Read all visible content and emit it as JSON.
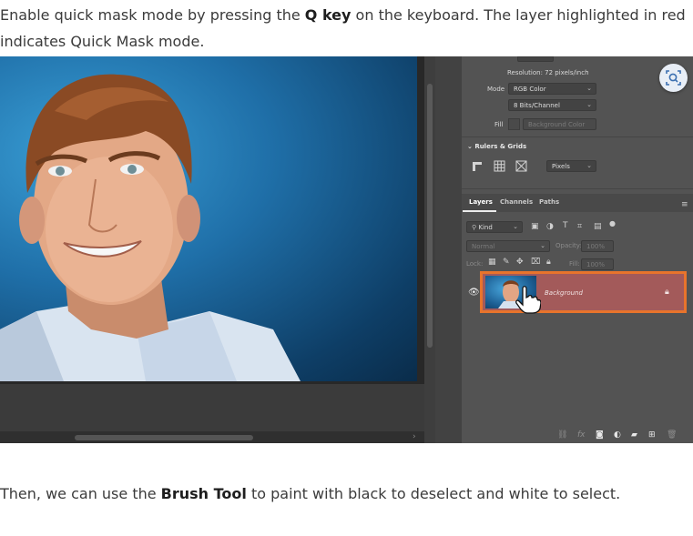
{
  "intro": {
    "text_before": "Enable quick mask mode by pressing the ",
    "key": "Q key",
    "text_after": " on the keyboard. The layer highlighted in red indicates Quick Mask mode."
  },
  "outro": {
    "text_before": "Then, we can use the ",
    "tool": "Brush Tool",
    "text_after": " to paint with black to deselect and white to select."
  },
  "panel": {
    "resolution": "Resolution: 72 pixels/inch",
    "mode_label": "Mode",
    "mode_value": "RGB Color",
    "bits_value": "8 Bits/Channel",
    "fill_label": "Fill",
    "fill_value": "Background Color",
    "rulers_title": "Rulers & Grids",
    "units_value": "Pixels"
  },
  "layers": {
    "tabs": [
      "Layers",
      "Channels",
      "Paths"
    ],
    "kind_placeholder": "Kind",
    "blend_mode": "Normal",
    "opacity_label": "Opacity:",
    "opacity_value": "100%",
    "lock_label": "Lock:",
    "fill_label": "Fill:",
    "fill_value": "100%",
    "layer_name": "Background"
  },
  "colors": {
    "quick_mask_highlight": "#a35a5a",
    "callout_border": "#e8742c",
    "panel_bg": "#535353"
  },
  "icons": [
    "search-icon",
    "eye-icon",
    "lock-icon",
    "hand-cursor-icon",
    "link-icon",
    "fx-icon",
    "mask-icon",
    "adjustment-icon",
    "folder-icon",
    "new-layer-icon",
    "trash-icon"
  ]
}
